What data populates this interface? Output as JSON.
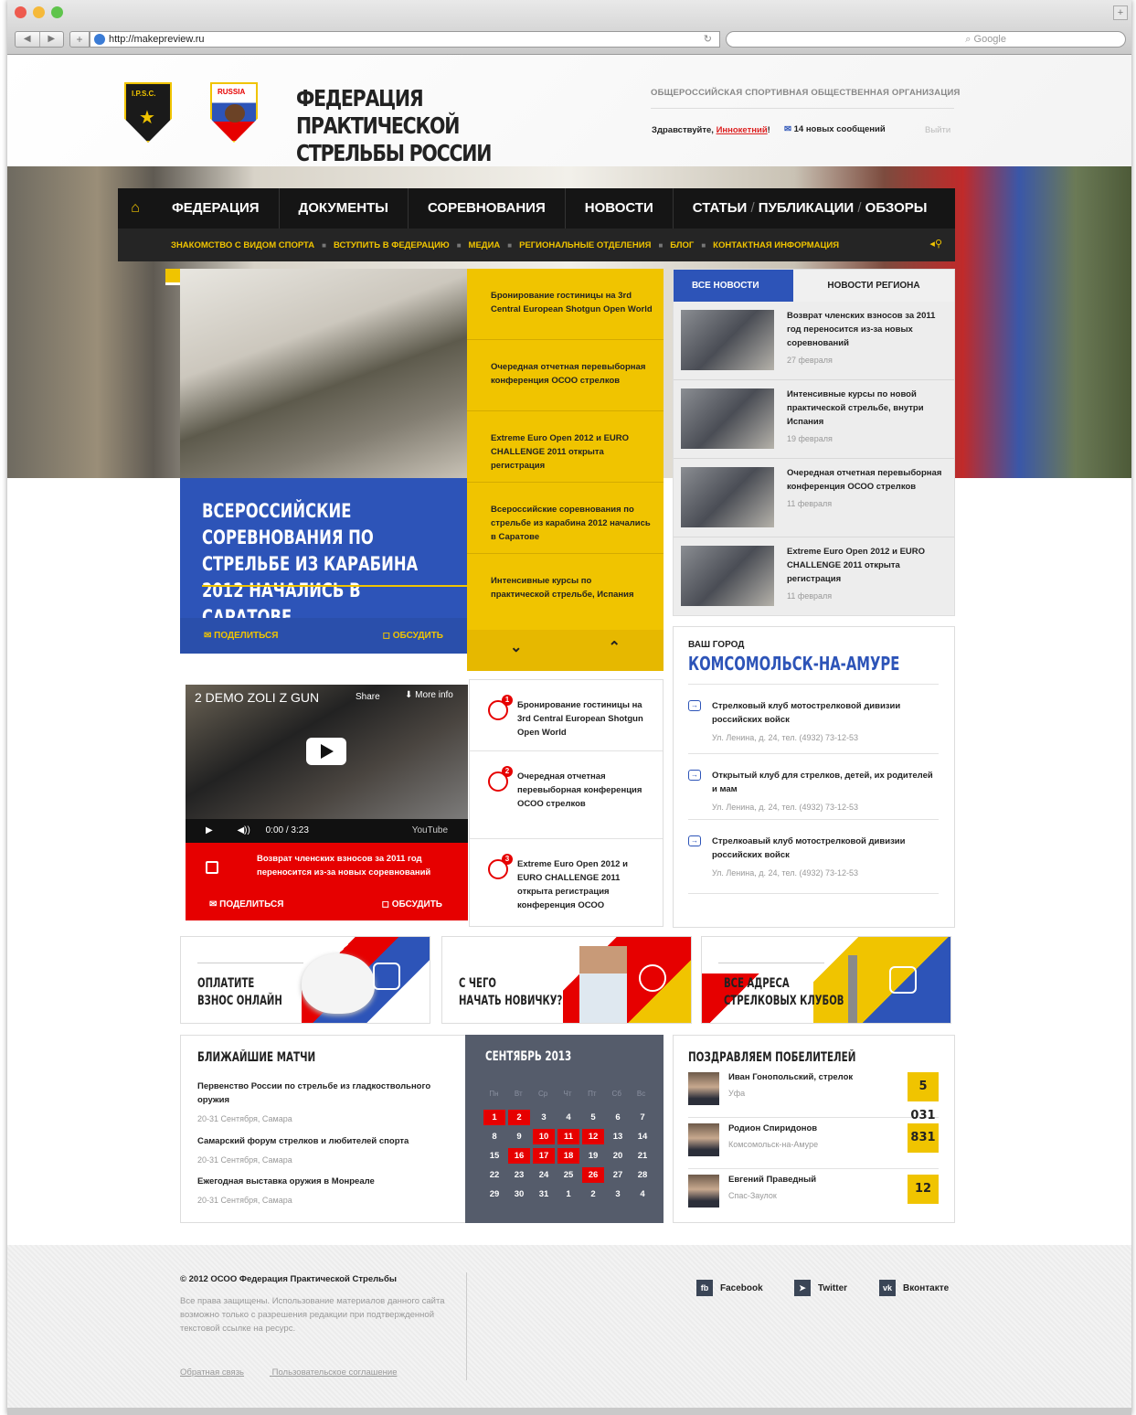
{
  "browser": {
    "url": "http://makepreview.ru",
    "search_placeholder": "Google"
  },
  "header": {
    "title_line1": "ФЕДЕРАЦИЯ ПРАКТИЧЕСКОЙ",
    "title_line2": "СТРЕЛЬБЫ РОССИИ",
    "org": "ОБЩЕРОССИЙСКАЯ СПОРТИВНАЯ ОБЩЕСТВЕННАЯ ОРГАНИЗАЦИЯ",
    "greeting": "Здравствуйте,",
    "user": "Иннокетний",
    "exclaim": "!",
    "messages": "14 новых сообщений",
    "logout": "Выйти",
    "logo1_text": "I.P.S.C.",
    "logo2_text": "RUSSIA"
  },
  "nav": {
    "items": [
      "ФЕДЕРАЦИЯ",
      "ДОКУМЕНТЫ",
      "СОРЕВНОВАНИЯ",
      "НОВОСТИ"
    ],
    "articles": "СТАТЬИ",
    "publications": "ПУБЛИКАЦИИ",
    "reviews": "ОБЗОРЫ",
    "sub": [
      "ЗНАКОМСТВО С ВИДОМ СПОРТА",
      "ВСТУПИТЬ В ФЕДЕРАЦИЮ",
      "МЕДИА",
      "РЕГИОНАЛЬНЫЕ ОТДЕЛЕНИЯ",
      "БЛОГ",
      "КОНТАКТНАЯ ИНФОРМАЦИЯ"
    ]
  },
  "feature": {
    "title": "ВСЕРОССИЙСКИЕ СОРЕВНОВАНИЯ ПО СТРЕЛЬБЕ ИЗ КАРАБИНА 2012 НАЧАЛИСЬ В САРАТОВЕ",
    "share": "ПОДЕЛИТЬСЯ",
    "discuss": "ОБСУДИТЬ"
  },
  "yellow_list": [
    "Бронирование гостиницы на 3rd Central European Shotgun Open World",
    "Очередная отчетная перевыборная конференция ОСОО стрелков",
    "Extreme Euro Open 2012 и EURO CHALLENGE 2011 открыта регистрация",
    "Всероссийские соревнования по стрельбе из карабина 2012 начались в Саратове",
    "Интенсивные курсы по практической стрельбе, Испания"
  ],
  "news": {
    "tab_all": "ВСЕ НОВОСТИ",
    "tab_region": "НОВОСТИ РЕГИОНА",
    "items": [
      {
        "text": "Возврат членских взносов за 2011 год переносится из-за новых соревнований",
        "date": "27 февраля"
      },
      {
        "text": "Интенсивные курсы по новой практической стрельбе, внутри Испания",
        "date": "19 февраля"
      },
      {
        "text": "Очередная отчетная перевыборная конференция ОСОО стрелков",
        "date": "11 февраля"
      },
      {
        "text": "Extreme Euro Open 2012 и EURO CHALLENGE 2011 открыта регистрация",
        "date": "11 февраля"
      }
    ]
  },
  "city": {
    "label": "ВАШ ГОРОД",
    "name": "КОМСОМОЛЬСК-НА-АМУРЕ",
    "items": [
      {
        "name": "Стрелковый клуб мотострелковой дивизии российских войск",
        "addr": "Ул. Ленина, д. 24, тел. (4932) 73-12-53"
      },
      {
        "name": "Открытый клуб для стрелков, детей, их родителей и мам",
        "addr": "Ул. Ленина, д. 24, тел. (4932) 73-12-53"
      },
      {
        "name": "Стрелкоавый клуб мотострелковой дивизии российских войск",
        "addr": "Ул. Ленина, д. 24, тел. (4932) 73-12-53"
      }
    ]
  },
  "video": {
    "title": "2 DEMO ZOLI Z GUN",
    "share_label": "Share",
    "more_label": "More info",
    "time": "0:00 / 3:23",
    "youtube": "YouTube",
    "caption": "Возврат членских взносов за 2011 год переносится из-за новых соревнований",
    "share": "ПОДЕЛИТЬСЯ",
    "discuss": "ОБСУДИТЬ"
  },
  "numbered": [
    {
      "n": "1",
      "text": "Бронирование гостиницы на 3rd Central European Shotgun Open World"
    },
    {
      "n": "2",
      "text": "Очередная отчетная перевыборная конференция ОСОО стрелков"
    },
    {
      "n": "3",
      "text": "Extreme Euro Open 2012 и EURO CHALLENGE 2011 открыта регистрация конференция ОСОО"
    }
  ],
  "tiles": [
    {
      "l1": "ОПЛАТИТЕ",
      "l2": "ВЗНОС ОНЛАЙН"
    },
    {
      "l1": "С ЧЕГО",
      "l2": "НАЧАТЬ НОВИЧКУ?"
    },
    {
      "l1": "ВСЕ АДРЕСА",
      "l2": "СТРЕЛКОВЫХ КЛУБОВ"
    }
  ],
  "matches": {
    "title": "БЛИЖАЙШИЕ МАТЧИ",
    "items": [
      {
        "name": "Первенство России по стрельбе из гладкоствольного оружия",
        "date": "20-31 Сентября, Самара"
      },
      {
        "name": "Самарский форум стрелков и любителей спорта",
        "date": "20-31 Сентября, Самара"
      },
      {
        "name": "Ежегодная выставка оружия в Монреале",
        "date": "20-31 Сентября, Самара"
      }
    ]
  },
  "calendar": {
    "title": "СЕНТЯБРЬ 2013",
    "dow": [
      "Пн",
      "Вт",
      "Ср",
      "Чт",
      "Пт",
      "Сб",
      "Вс"
    ],
    "days": [
      "1",
      "2",
      "3",
      "4",
      "5",
      "6",
      "7",
      "8",
      "9",
      "10",
      "11",
      "12",
      "13",
      "14",
      "15",
      "16",
      "17",
      "18",
      "19",
      "20",
      "21",
      "22",
      "23",
      "24",
      "25",
      "26",
      "27",
      "28",
      "29",
      "30",
      "31",
      "1",
      "2",
      "3",
      "4"
    ],
    "highlighted": [
      0,
      1,
      9,
      10,
      11,
      15,
      16,
      17,
      25
    ]
  },
  "winners": {
    "title": "ПОЗДРАВЛЯЕМ ПОБЕЛИТЕЛЕЙ",
    "items": [
      {
        "name": "Иван Гонопольский, стрелок",
        "city": "Уфа",
        "score": "5 031"
      },
      {
        "name": "Родион Спиридонов",
        "city": "Комсомольск-на-Амуре",
        "score": "831"
      },
      {
        "name": "Евгений Праведный",
        "city": "Спас-Заулок",
        "score": "12"
      }
    ]
  },
  "footer": {
    "copyright": "© 2012 ОСОО Федерация Практической Стрельбы",
    "rights": "Все права защищены. Использование материалов данного сайта возможно только с разрешения редакции при подтвержденной текстовой ссылке на ресурс.",
    "feedback": "Обратная связь",
    "agreement": "Пользовательское соглашение",
    "social": [
      {
        "icon": "fb",
        "label": "Facebook"
      },
      {
        "icon": "twitter-bird",
        "label": "Twitter"
      },
      {
        "icon": "vk",
        "label": "Вконтакте"
      }
    ]
  },
  "colors": {
    "accent_yellow": "#f0c400",
    "accent_blue": "#2d54b8",
    "accent_red": "#e60000",
    "calendar_bg": "#555c6b"
  }
}
